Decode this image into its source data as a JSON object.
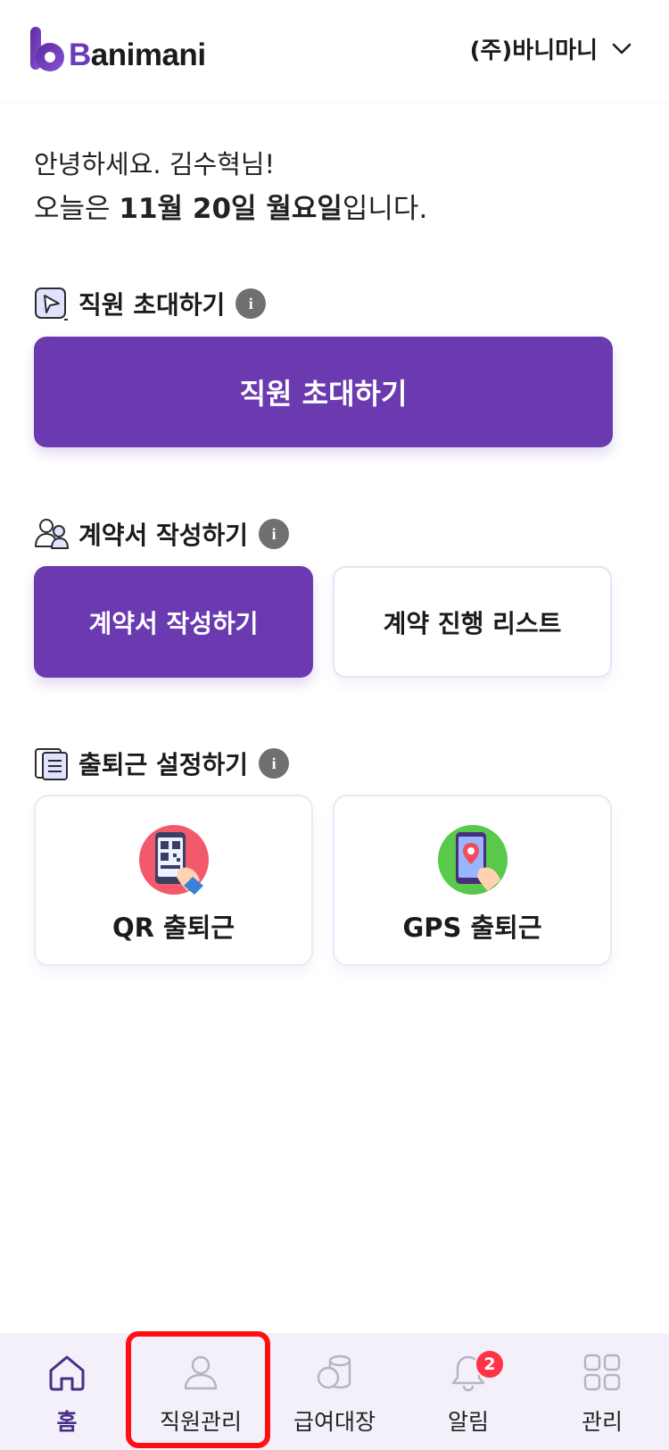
{
  "header": {
    "logo_letter": "B",
    "logo_rest": "animani",
    "company_name": "(주)바니마니"
  },
  "greeting": {
    "line1": "안녕하세요. 김수혁님!",
    "line2_prefix": "오늘은 ",
    "line2_date": "11월 20일 월요일",
    "line2_suffix": "입니다."
  },
  "sections": {
    "invite": {
      "title": "직원 초대하기",
      "button_label": "직원 초대하기"
    },
    "contract": {
      "title": "계약서 작성하기",
      "primary_label": "계약서 작성하기",
      "secondary_label": "계약 진행 리스트"
    },
    "attendance": {
      "title": "출퇴근 설정하기",
      "qr_label": "QR 출퇴근",
      "gps_label": "GPS 출퇴근"
    }
  },
  "info_glyph": "i",
  "tabbar": {
    "items": [
      {
        "label": "홈",
        "icon": "home-icon",
        "active": true
      },
      {
        "label": "직원관리",
        "icon": "person-icon",
        "active": false
      },
      {
        "label": "급여대장",
        "icon": "coins-icon",
        "active": false
      },
      {
        "label": "알림",
        "icon": "bell-icon",
        "active": false,
        "badge": "2"
      },
      {
        "label": "관리",
        "icon": "grid-icon",
        "active": false
      }
    ]
  },
  "colors": {
    "brand_purple": "#6b3ab0",
    "tabbar_bg": "#f3f0f9",
    "badge_red": "#ff3347",
    "highlight_red": "#ff0f14"
  }
}
